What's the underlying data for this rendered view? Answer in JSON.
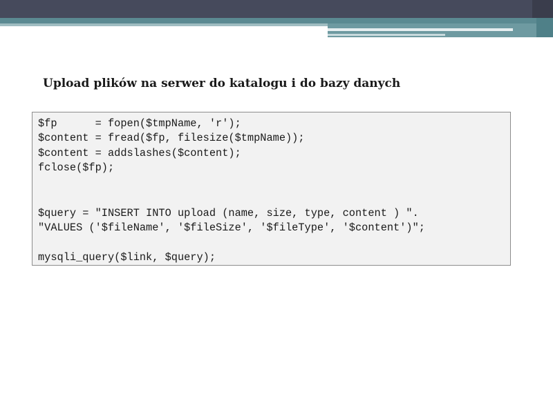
{
  "slide": {
    "title": "Upload plików na serwer do katalogu i do bazy danych",
    "code_lines": [
      "$fp      = fopen($tmpName, 'r');",
      "$content = fread($fp, filesize($tmpName));",
      "$content = addslashes($content);",
      "fclose($fp);",
      "$query = \"INSERT INTO upload (name, size, type, content ) \".",
      "\"VALUES ('$fileName', '$fileSize', '$fileType', '$content')\";",
      "mysqli_query($link, $query);"
    ]
  },
  "colors": {
    "header_dark": "#464a5c",
    "header_teal": "#5b8a92",
    "code_background": "#f2f2f2",
    "code_border": "#8c8c8c"
  }
}
